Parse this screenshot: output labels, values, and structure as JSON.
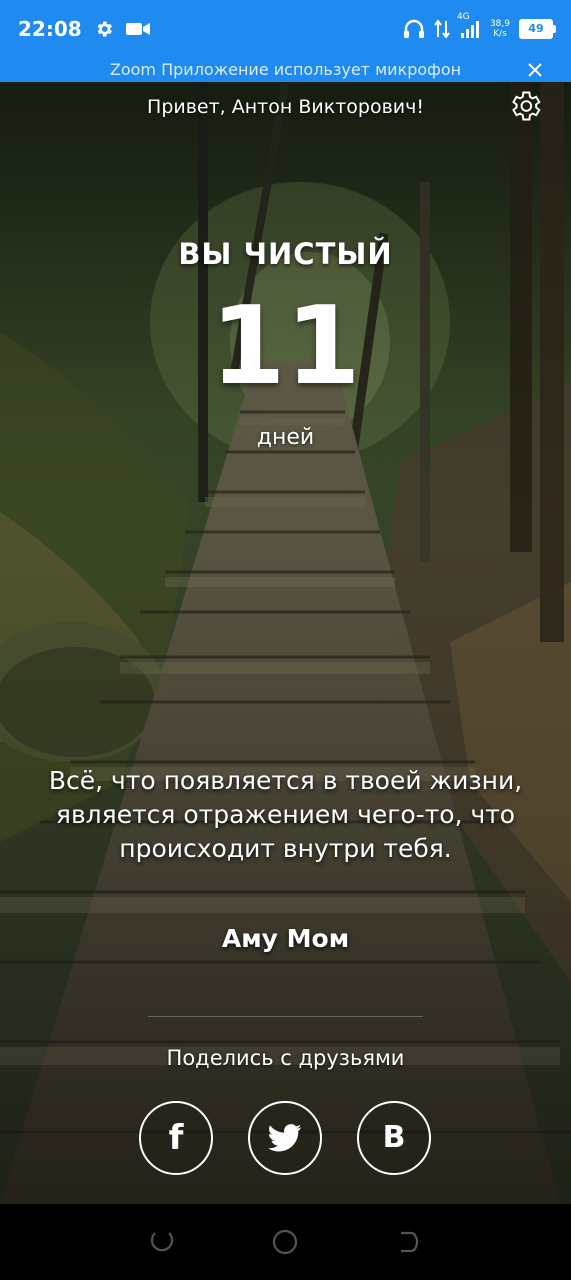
{
  "status_bar": {
    "time": "22:08",
    "network_type": "4G",
    "speed_value": "38,9",
    "speed_unit": "K/s",
    "battery_level": "49",
    "icons": [
      "settings-icon",
      "video-camera-icon",
      "headphones-icon",
      "data-transfer-icon",
      "signal-icon",
      "battery-icon"
    ]
  },
  "banner": {
    "text": "Zoom Приложение использует микрофон",
    "close_icon": "close-icon"
  },
  "header": {
    "greeting": "Привет, Антон Викторович!",
    "settings_icon": "gear-icon"
  },
  "counter": {
    "label": "ВЫ ЧИСТЫЙ",
    "value": "11",
    "unit": "дней"
  },
  "quote": {
    "text": "Всё, что появляется в твоей жизни, является отражением чего-то, что происходит внутри тебя.",
    "author": "Аму Мом"
  },
  "share": {
    "label": "Поделись с друзьями",
    "buttons": [
      {
        "name": "facebook",
        "glyph": "f"
      },
      {
        "name": "twitter",
        "glyph": "twitter-bird"
      },
      {
        "name": "vk",
        "glyph": "B"
      }
    ]
  },
  "nav_bar": {
    "buttons": [
      "back-icon",
      "home-icon",
      "recents-icon"
    ]
  },
  "colors": {
    "status_bar": "#1f8af0",
    "text": "#ffffff",
    "nav_bar": "#000000"
  }
}
